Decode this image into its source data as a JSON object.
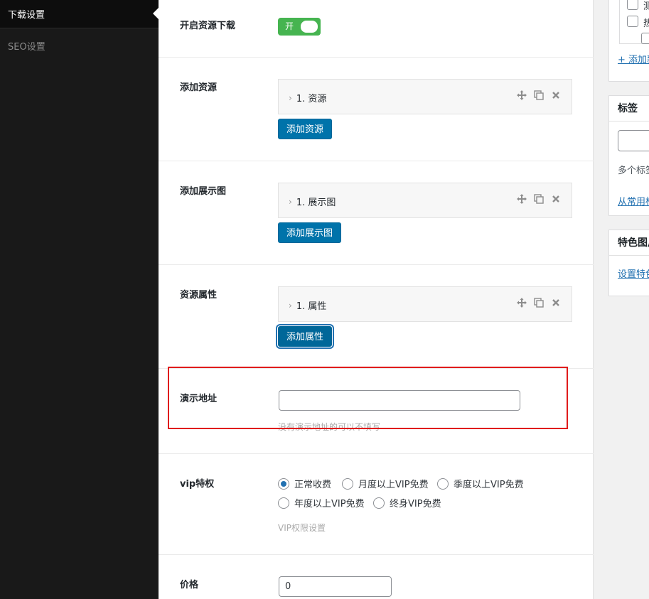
{
  "nav": {
    "active_item": "下载设置",
    "seo_item": "SEO设置"
  },
  "fields": {
    "download_toggle": {
      "label": "开启资源下载",
      "state_text": "开"
    },
    "resources": {
      "label": "添加资源",
      "item_title": "1. 资源",
      "add_button": "添加资源"
    },
    "gallery": {
      "label": "添加展示图",
      "item_title": "1. 展示图",
      "add_button": "添加展示图"
    },
    "attributes": {
      "label": "资源属性",
      "item_title": "1. 属性",
      "add_button": "添加属性"
    },
    "demo_url": {
      "label": "演示地址",
      "value": "",
      "hint": "没有演示地址的可以不填写"
    },
    "vip": {
      "label": "vip特权",
      "options": [
        "正常收费",
        "月度以上VIP免费",
        "季度以上VIP免费",
        "年度以上VIP免费",
        "终身VIP免费"
      ],
      "selected": "正常收费",
      "hint": "VIP权限设置"
    },
    "price": {
      "label": "价格",
      "value": "0"
    }
  },
  "sidebar": {
    "categories": {
      "add_link": "+ 添加新分类",
      "items": [
        "测",
        "热"
      ]
    },
    "tags": {
      "title": "标签",
      "hint": "多个标签请用英文逗号分开",
      "link": "从常用标签中选择"
    },
    "featured": {
      "title": "特色图片",
      "link": "设置特色图片"
    }
  },
  "colors": {
    "accent": "#0073aa",
    "toggle_on": "#46b450",
    "highlight": "#e01b1b"
  }
}
